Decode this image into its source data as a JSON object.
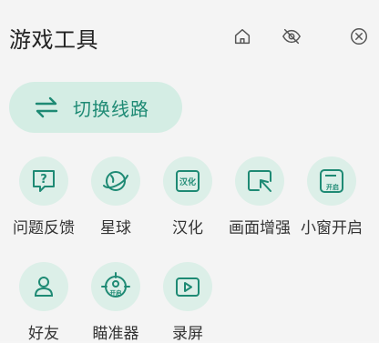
{
  "header": {
    "title": "游戏工具"
  },
  "top_icons": [
    {
      "icon": "home-icon"
    },
    {
      "icon": "eye-off-icon"
    },
    {
      "icon": "close-icon"
    }
  ],
  "switch_route": {
    "label": "切换线路",
    "icon": "swap-arrows-icon"
  },
  "tools": [
    {
      "label": "问题反馈",
      "icon": "question-icon",
      "badge": "?"
    },
    {
      "label": "星球",
      "icon": "planet-icon"
    },
    {
      "label": "汉化",
      "icon": "translate-icon",
      "badge": "汉化"
    },
    {
      "label": "画面增强",
      "icon": "enhance-icon"
    },
    {
      "label": "小窗开启",
      "icon": "small-window-icon",
      "badge": "开启"
    },
    {
      "label": "好友",
      "icon": "friend-icon"
    },
    {
      "label": "瞄准器",
      "icon": "crosshair-icon",
      "badge": "开启"
    },
    {
      "label": "录屏",
      "icon": "record-icon"
    }
  ],
  "colors": {
    "accent": "#1e8a74",
    "button_bg": "#d4ede4",
    "icon_bg": "#dcefe8",
    "background": "#f4f4f4"
  }
}
